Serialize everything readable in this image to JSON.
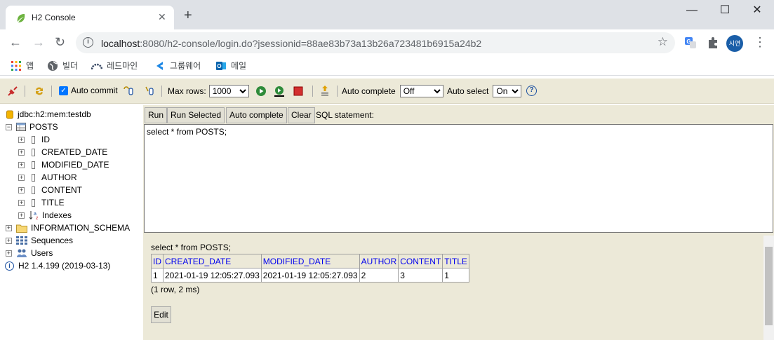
{
  "browser": {
    "tab_title": "H2 Console",
    "url_host": "localhost",
    "url_path": ":8080/h2-console/login.do?jsessionid=88ae83b73a13b26a723481b6915a24b2",
    "profile_initials": "시연",
    "bookmarks": [
      {
        "label": "앱",
        "icon": "apps-grid-icon"
      },
      {
        "label": "빌더",
        "icon": "globe-icon"
      },
      {
        "label": "레드마인",
        "icon": "redmine-icon"
      },
      {
        "label": "그룹웨어",
        "icon": "groupware-icon"
      },
      {
        "label": "메일",
        "icon": "outlook-icon"
      }
    ]
  },
  "h2toolbar": {
    "auto_commit_label": "Auto commit",
    "auto_commit_checked": true,
    "max_rows_label": "Max rows:",
    "max_rows_value": "1000",
    "auto_complete_label": "Auto complete",
    "auto_complete_value": "Off",
    "auto_select_label": "Auto select",
    "auto_select_value": "On",
    "help_symbol": "?"
  },
  "tree": {
    "connection": "jdbc:h2:mem:testdb",
    "table": "POSTS",
    "columns": [
      "ID",
      "CREATED_DATE",
      "MODIFIED_DATE",
      "AUTHOR",
      "CONTENT",
      "TITLE"
    ],
    "indexes": "Indexes",
    "schema": "INFORMATION_SCHEMA",
    "sequences": "Sequences",
    "users": "Users",
    "version": "H2 1.4.199 (2019-03-13)"
  },
  "query": {
    "buttons": {
      "run": "Run",
      "run_selected": "Run Selected",
      "auto_complete": "Auto complete",
      "clear": "Clear"
    },
    "sql_label": "SQL statement:",
    "sql_text": "select * from POSTS;"
  },
  "results": {
    "query_echo": "select * from POSTS;",
    "headers": [
      "ID",
      "CREATED_DATE",
      "MODIFIED_DATE",
      "AUTHOR",
      "CONTENT",
      "TITLE"
    ],
    "rows": [
      [
        "1",
        "2021-01-19 12:05:27.093",
        "2021-01-19 12:05:27.093",
        "2",
        "3",
        "1"
      ]
    ],
    "row_info": "(1 row, 2 ms)",
    "edit_label": "Edit"
  }
}
